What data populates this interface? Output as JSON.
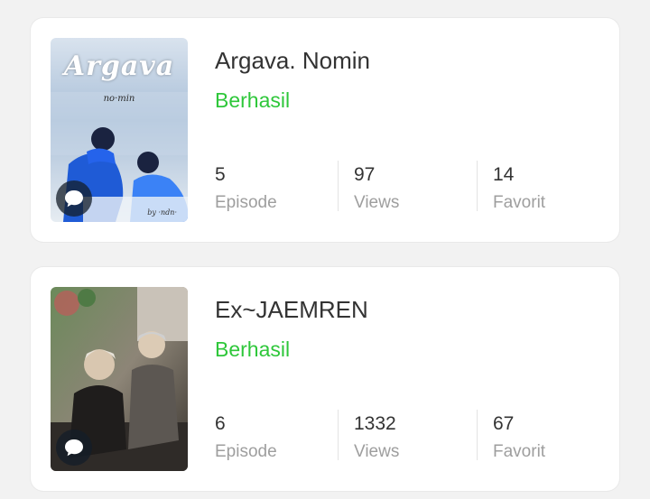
{
  "novels": [
    {
      "title": "Argava. Nomin",
      "status": "Berhasil",
      "cover": {
        "title_text": "Argava",
        "subtitle_text": "no·min",
        "signature_text": "by ·ndn·"
      },
      "stats": [
        {
          "value": "5",
          "label": "Episode"
        },
        {
          "value": "97",
          "label": "Views"
        },
        {
          "value": "14",
          "label": "Favorit"
        }
      ]
    },
    {
      "title": "Ex~JAEMREN",
      "status": "Berhasil",
      "stats": [
        {
          "value": "6",
          "label": "Episode"
        },
        {
          "value": "1332",
          "label": "Views"
        },
        {
          "value": "67",
          "label": "Favorit"
        }
      ]
    }
  ],
  "colors": {
    "status_green": "#2ec73a",
    "background": "#f2f2f2",
    "card": "#ffffff"
  },
  "icons": {
    "comment_badge": "chat-bubble-icon"
  }
}
